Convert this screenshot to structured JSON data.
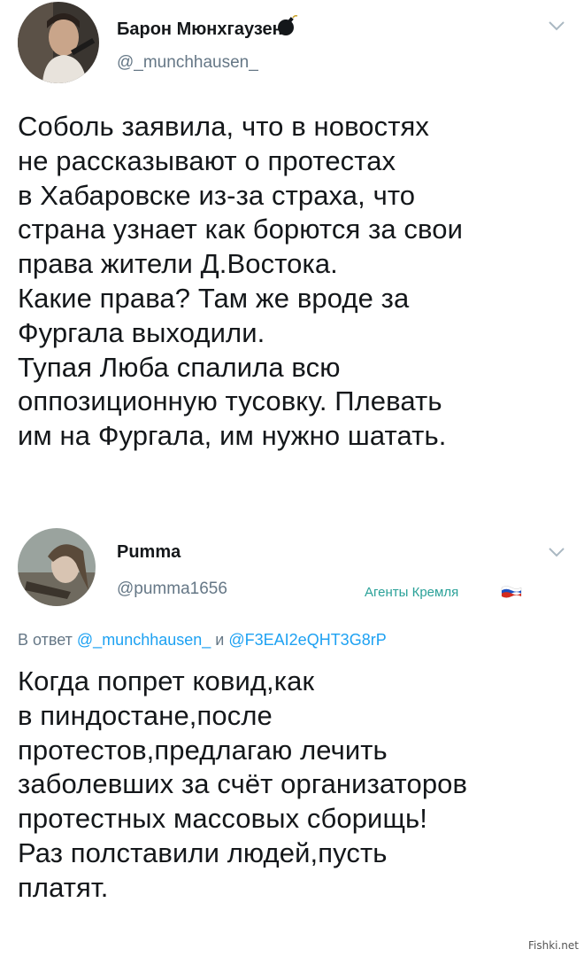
{
  "tweet1": {
    "author_name": "Барон Мюнхгаузен",
    "author_handle": "@_munchhausen_",
    "text": "Соболь заявила, что в новостях\nне рассказывают о протестах\nв Хабаровске из-за страха, что\nстрана узнает как борются за свои\nправа жители Д.Востока.\nКакие права? Там же вроде за\nФургала выходили.\nТупая Люба спалила всю\nоппозиционную тусовку. Плевать\nим на Фургала, им нужно шатать.",
    "name_icon": "bomb-icon",
    "menu_icon": "chevron-down-icon"
  },
  "tweet2": {
    "author_name": "Pumma",
    "author_handle": "@pumma1656",
    "badge": "Агенты Кремля",
    "badge_icon": "russian-flag-icon",
    "reply_prefix": "В ответ",
    "reply_mention_1": "@_munchhausen_",
    "reply_and": "и",
    "reply_mention_2": "@F3EAI2eQHT3G8rP",
    "text": "Когда попрет ковид,как\nв пиндостане,после\nпротестов,предлагаю лечить\nзаболевших за счёт организаторов\nпротестных массовых сборищь!\nРаз полставили людей,пусть\nплатят.",
    "menu_icon": "chevron-down-icon"
  },
  "watermark": "Fishki.net",
  "colors": {
    "text": "#14171a",
    "secondary": "#657786",
    "mention": "#1da1f2",
    "badge": "#2aa198"
  }
}
